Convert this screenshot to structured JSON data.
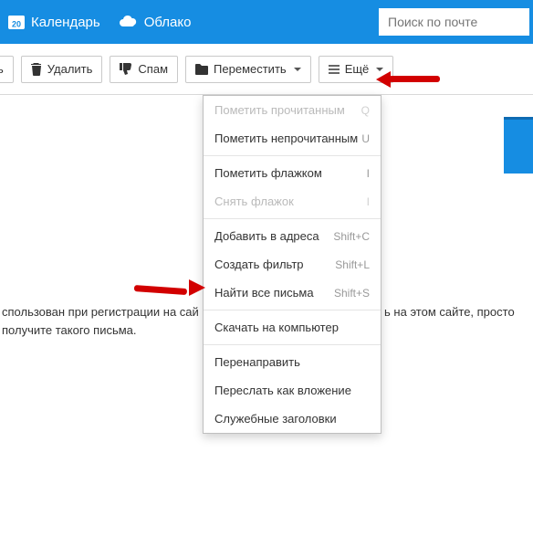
{
  "header": {
    "calendar": {
      "label": "Календарь",
      "day": "20"
    },
    "cloud_label": "Облако",
    "search_placeholder": "Поиск по почте"
  },
  "toolbar": {
    "reply_tail": "ь",
    "delete_label": "Удалить",
    "spam_label": "Спам",
    "move_label": "Переместить",
    "more_label": "Ещё"
  },
  "menu": {
    "mark_read": {
      "label": "Пометить прочитанным",
      "key": "Q"
    },
    "mark_unread": {
      "label": "Пометить непрочитанным",
      "key": "U"
    },
    "flag": {
      "label": "Пометить флажком",
      "key": "I"
    },
    "unflag": {
      "label": "Снять флажок",
      "key": "I"
    },
    "add_addr": {
      "label": "Добавить в адреса",
      "key": "Shift+C"
    },
    "filter": {
      "label": "Создать фильтр",
      "key": "Shift+L"
    },
    "find_all": {
      "label": "Найти все письма",
      "key": "Shift+S"
    },
    "download": {
      "label": "Скачать на компьютер"
    },
    "redirect": {
      "label": "Перенаправить"
    },
    "fwd_attach": {
      "label": "Переслать как вложение"
    },
    "headers": {
      "label": "Служебные заголовки"
    }
  },
  "body": {
    "line1_left": "спользован при регистрации на сай",
    "line1_right": "ь на этом сайте, просто",
    "line2": "получите такого письма."
  }
}
